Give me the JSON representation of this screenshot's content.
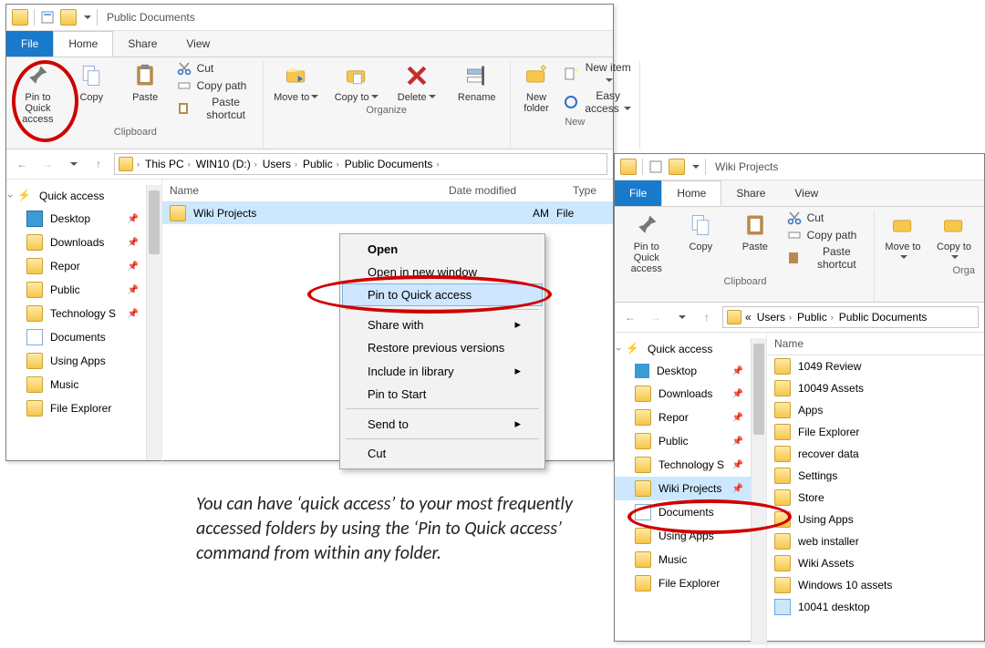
{
  "win1": {
    "title": "Public Documents",
    "menu": {
      "file": "File",
      "home": "Home",
      "share": "Share",
      "view": "View"
    },
    "ribbon": {
      "pin": "Pin to Quick access",
      "copy": "Copy",
      "paste": "Paste",
      "cut": "Cut",
      "copypath": "Copy path",
      "pastesc": "Paste shortcut",
      "clipboard": "Clipboard",
      "moveto": "Move to",
      "copyto": "Copy to",
      "delete": "Delete",
      "rename": "Rename",
      "organize": "Organize",
      "newfolder": "New folder",
      "newitem": "New item",
      "easyaccess": "Easy access",
      "new": "New"
    },
    "crumbs": [
      "This PC",
      "WIN10 (D:)",
      "Users",
      "Public",
      "Public Documents"
    ],
    "cols": {
      "name": "Name",
      "date": "Date modified",
      "type": "Type"
    },
    "file": {
      "name": "Wiki Projects",
      "date": "AM",
      "type": "File"
    },
    "sidebar": {
      "qa": "Quick access",
      "items": [
        "Desktop",
        "Downloads",
        "Repor",
        "Public",
        "Technology S",
        "Documents",
        "Using Apps",
        "Music",
        "File Explorer"
      ]
    },
    "ctx": {
      "open": "Open",
      "opennew": "Open in new window",
      "pin": "Pin to Quick access",
      "share": "Share with",
      "restore": "Restore previous versions",
      "library": "Include in library",
      "pinstart": "Pin to Start",
      "sendto": "Send to",
      "cut": "Cut"
    }
  },
  "win2": {
    "title": "Wiki Projects",
    "menu": {
      "file": "File",
      "home": "Home",
      "share": "Share",
      "view": "View"
    },
    "ribbon": {
      "pin": "Pin to Quick access",
      "copy": "Copy",
      "paste": "Paste",
      "cut": "Cut",
      "copypath": "Copy path",
      "pastesc": "Paste shortcut",
      "clipboard": "Clipboard",
      "moveto": "Move to",
      "copyto": "Copy to",
      "organize": "Orga"
    },
    "crumbs_prefix": "«",
    "crumbs": [
      "Users",
      "Public",
      "Public Documents"
    ],
    "cols": {
      "name": "Name"
    },
    "sidebar": {
      "qa": "Quick access",
      "items": [
        "Desktop",
        "Downloads",
        "Repor",
        "Public",
        "Technology S",
        "Wiki Projects",
        "Documents",
        "Using Apps",
        "Music",
        "File Explorer"
      ]
    },
    "files": [
      "1049 Review",
      "10049 Assets",
      "Apps",
      "File Explorer",
      "recover data",
      "Settings",
      "Store",
      "Using Apps",
      "web installer",
      "Wiki Assets",
      "Windows 10 assets",
      "10041 desktop"
    ]
  },
  "caption": "You can have ‘quick access’ to your most frequently accessed folders by using the ‘Pin to Quick access’ command from within any folder."
}
